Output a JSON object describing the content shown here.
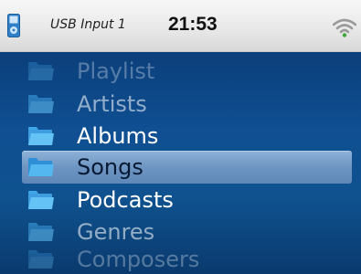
{
  "status_bar": {
    "source": "USB Input 1",
    "time": "21:53",
    "device_icon": "ipod-icon",
    "signal_icon": "wifi-icon"
  },
  "menu": {
    "items": [
      {
        "label": "Playlist",
        "icon": "folder-icon",
        "selected": false
      },
      {
        "label": "Artists",
        "icon": "folder-icon",
        "selected": false
      },
      {
        "label": "Albums",
        "icon": "folder-icon",
        "selected": false
      },
      {
        "label": "Songs",
        "icon": "folder-icon",
        "selected": true
      },
      {
        "label": "Podcasts",
        "icon": "folder-icon",
        "selected": false
      },
      {
        "label": "Genres",
        "icon": "folder-icon",
        "selected": false
      },
      {
        "label": "Composers",
        "icon": "folder-icon",
        "selected": false
      }
    ]
  },
  "colors": {
    "status_bar_bg": "#eeeeee",
    "list_bg": "#0f4f92",
    "selection_bg": "#7aa0cb",
    "folder_icon": "#4fb3ee",
    "wifi_green": "#3ea83a"
  }
}
